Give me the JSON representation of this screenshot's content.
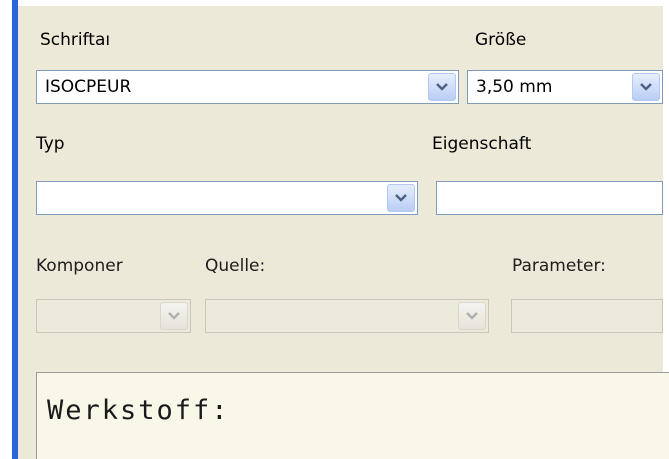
{
  "font": {
    "label": "Schriftaı",
    "value": "ISOCPEUR"
  },
  "size": {
    "label": "Größe",
    "value": "3,50 mm"
  },
  "type": {
    "label": "Typ",
    "value": ""
  },
  "property": {
    "label": "Eigenschaft",
    "value": ""
  },
  "component": {
    "label": "Komponer",
    "value": ""
  },
  "source": {
    "label": "Quelle:",
    "value": ""
  },
  "parameter": {
    "label": "Parameter:",
    "value": ""
  },
  "preview": {
    "text": "Werkstoff:"
  },
  "colors": {
    "background": "#ece9d8",
    "accent": "#2f63d8",
    "field_border": "#7f9db9",
    "disabled_field": "#ebeadb",
    "preview_background": "#f8f7e8"
  }
}
